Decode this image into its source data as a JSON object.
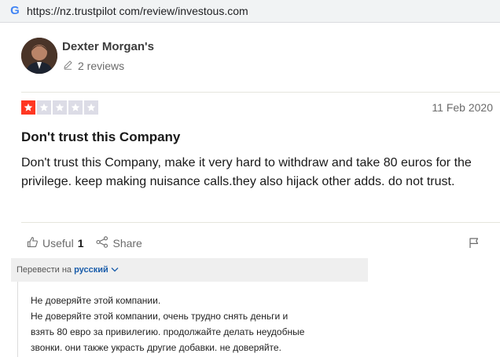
{
  "browser": {
    "url": "https://nz.trustpilot com/review/investous.com"
  },
  "review": {
    "author": "Dexter Morgan's",
    "reviews_count": "2 reviews",
    "rating": 1,
    "rating_max": 5,
    "date": "11 Feb 2020",
    "title": "Don't trust this Company",
    "body": "Don't trust this Company, make it very hard to withdraw and take 80 euros for the privilege. keep making nuisance calls.they also hijack other adds. do not trust.",
    "useful_label": "Useful",
    "useful_count": "1",
    "share_label": "Share"
  },
  "translation": {
    "prefix": "Перевести на",
    "language": "русский",
    "lines": [
      "Не доверяйте этой компании.",
      "Не доверяйте этой компании, очень трудно снять деньги и",
      "взять 80 евро за привилегию. продолжайте делать неудобные",
      "звонки. они также украсть другие добавки. не доверяйте."
    ]
  },
  "colors": {
    "star_active": "#ff3722",
    "star_inactive": "#dcdce6",
    "link": "#1a5dab"
  }
}
